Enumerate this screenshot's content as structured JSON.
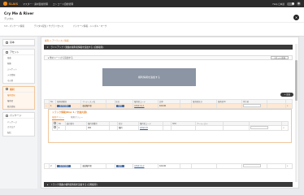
{
  "topbar": {
    "logo": "SLAIS",
    "nav": [
      "マスター・素材自動管理",
      "エンコード自動管理"
    ],
    "user_label": "Help 日本語",
    "close": "✕"
  },
  "header": {
    "title": "Cry Me A River",
    "subtitle": "デジタル",
    "crumbs": [
      "3.3 - パッケージ情報",
      "デジタル配信 / サブライセンス",
      "パッケージ情報 - シンボル・マーク"
    ]
  },
  "sidebar": {
    "groups": [
      {
        "label": "基本",
        "items": []
      },
      {
        "label": "アセット",
        "items": [
          "楽曲",
          "映像",
          "ジャケット",
          "メタ情報",
          "その他"
        ]
      },
      {
        "label": "権利",
        "items": [
          "権利情報",
          "権利者",
          "販売情報"
        ],
        "active": true
      },
      {
        "label": "パッケージ",
        "items": [
          "パッケージ",
          "カタログ",
          "配信"
        ]
      }
    ]
  },
  "main": {
    "breadcrumb": "権利 > アーティスト情報",
    "section1": "ラインアップ / 楽曲の権利者情報を追加する (自動取得)",
    "sub_row_label": "他のシートから追加する",
    "sub_row_button": "リセット追加",
    "dropzone": "権利情報を追加する",
    "add_pill": "+ 追加",
    "table1": {
      "headers": [
        "",
        "No",
        "権利者種別",
        "アーティスト名",
        "",
        "区分",
        "権利者コード",
        "比率",
        "",
        "権利者区分",
        "権利者ID",
        "代行者",
        "",
        ""
      ],
      "row": [
        "⌄",
        "1",
        "権利者選択",
        "楽曲権利者",
        "",
        "権利",
        "Artist-Co-1",
        "100.00",
        "",
        "",
        "",
        "",
        "",
        "✕"
      ]
    },
    "subpanel": {
      "title": "トラック情報(Disc 1 / 全曲共通)",
      "tabs": [
        "楽曲ポリシー",
        "映像ポリシー"
      ],
      "headers": [
        "",
        "No",
        "曲目番号",
        "権利者種別",
        "",
        "区分",
        "権利者コード",
        "",
        "ISRC",
        "アーティスト",
        "",
        "",
        ""
      ],
      "row": [
        "",
        "1",
        "",
        "001",
        "",
        "権利",
        "Artist-01",
        "",
        "",
        "",
        "",
        "",
        "✕"
      ]
    },
    "table2": {
      "row": [
        "⌄",
        "2",
        "権利者選択",
        "楽曲権利者",
        "",
        "権利",
        "Artist-Co-2",
        "100.00",
        "",
        "",
        "",
        "",
        "",
        "✕"
      ]
    },
    "section2": "トラック楽曲の権利者情報を追加する (自動取得)"
  }
}
